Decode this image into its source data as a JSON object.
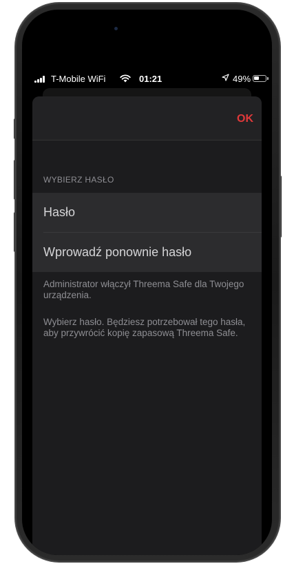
{
  "status_bar": {
    "carrier": "T-Mobile WiFi",
    "time": "01:21",
    "battery_percent": "49%",
    "battery_level": 0.49,
    "icons": [
      "signal-icon",
      "wifi-icon",
      "location-arrow-icon",
      "battery-icon"
    ]
  },
  "nav": {
    "ok_label": "OK"
  },
  "form": {
    "section_header": "WYBIERZ HASŁO",
    "password_placeholder": "Hasło",
    "confirm_placeholder": "Wprowadź ponownie hasło"
  },
  "footer": {
    "admin_note": "Administrator włączył Threema Safe dla Twojego urządzenia.",
    "instruction": "Wybierz hasło. Będziesz potrzebował tego hasła, aby przywrócić kopię zapasową Threema Safe."
  },
  "colors": {
    "accent": "#e0393a",
    "background": "#1c1c1e",
    "cell": "#2c2c2e",
    "secondary_text": "#8e8e93"
  }
}
